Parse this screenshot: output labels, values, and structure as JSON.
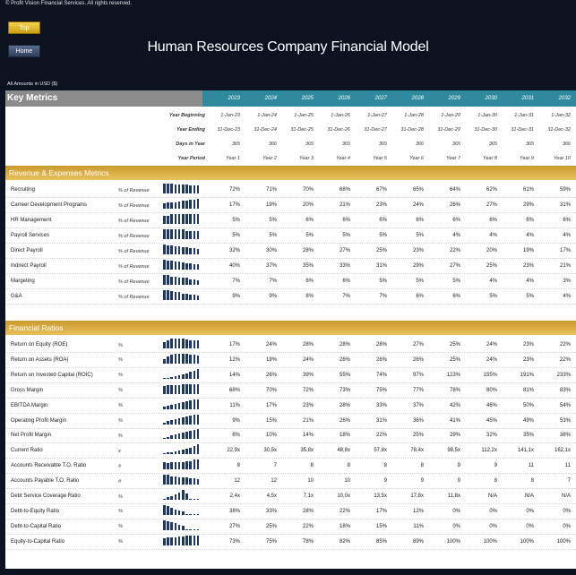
{
  "copyright": "© Profit Vision Financial Services. All rights reserved.",
  "nav": {
    "top_label": "Top",
    "home_label": "Home"
  },
  "title": "Human Resources Company Financial Model",
  "amounts_note": "All Amounts in  USD ($)",
  "key_metrics_label": "Key Metrics",
  "years": [
    "2023",
    "2024",
    "2025",
    "2026",
    "2027",
    "2028",
    "2029",
    "2030",
    "2031",
    "2032"
  ],
  "meta_rows": [
    {
      "label": "Year Beginning",
      "values": [
        "1-Jan-23",
        "1-Jan-24",
        "1-Jan-25",
        "1-Jan-26",
        "1-Jan-27",
        "1-Jan-28",
        "1-Jan-29",
        "1-Jan-30",
        "1-Jan-31",
        "1-Jan-32"
      ]
    },
    {
      "label": "Year Ending",
      "values": [
        "31-Dec-23",
        "31-Dec-24",
        "31-Dec-25",
        "31-Dec-26",
        "31-Dec-27",
        "31-Dec-28",
        "31-Dec-29",
        "31-Dec-30",
        "31-Dec-31",
        "31-Dec-32"
      ]
    },
    {
      "label": "Days in Year",
      "values": [
        "365",
        "366",
        "365",
        "365",
        "365",
        "366",
        "365",
        "365",
        "365",
        "366"
      ]
    },
    {
      "label": "Year Period",
      "values": [
        "Year 1",
        "Year 2",
        "Year 3",
        "Year 4",
        "Year 5",
        "Year 6",
        "Year 7",
        "Year 8",
        "Year 9",
        "Year 10"
      ]
    }
  ],
  "sections": [
    {
      "title": "Revenue & Expenses Metrics",
      "rows": [
        {
          "label": "Recruiting",
          "unit": "% of Revenue",
          "values": [
            "72%",
            "71%",
            "70%",
            "68%",
            "67%",
            "65%",
            "64%",
            "62%",
            "61%",
            "59%"
          ],
          "spark": [
            72,
            71,
            70,
            68,
            67,
            65,
            64,
            62,
            61,
            59
          ]
        },
        {
          "label": "Carreer Development Programs",
          "unit": "% of Revenue",
          "values": [
            "17%",
            "19%",
            "20%",
            "21%",
            "23%",
            "24%",
            "26%",
            "27%",
            "29%",
            "31%"
          ],
          "spark": [
            17,
            19,
            20,
            21,
            23,
            24,
            26,
            27,
            29,
            31
          ]
        },
        {
          "label": "HR Management",
          "unit": "% of Revenue",
          "values": [
            "5%",
            "5%",
            "6%",
            "6%",
            "6%",
            "6%",
            "6%",
            "6%",
            "6%",
            "6%"
          ],
          "spark": [
            5,
            5,
            6,
            6,
            6,
            6,
            6,
            6,
            6,
            6
          ]
        },
        {
          "label": "Payroll Services",
          "unit": "% of Revenue",
          "values": [
            "5%",
            "5%",
            "5%",
            "5%",
            "5%",
            "5%",
            "4%",
            "4%",
            "4%",
            "4%"
          ],
          "spark": [
            5,
            5,
            5,
            5,
            5,
            5,
            4,
            4,
            4,
            4
          ]
        },
        {
          "label": "Direct Payroll",
          "unit": "% of Revenue",
          "values": [
            "32%",
            "30%",
            "28%",
            "27%",
            "25%",
            "23%",
            "22%",
            "20%",
            "19%",
            "17%"
          ],
          "spark": [
            32,
            30,
            28,
            27,
            25,
            23,
            22,
            20,
            19,
            17
          ]
        },
        {
          "label": "Indirect Payroll",
          "unit": "% of Revenue",
          "values": [
            "40%",
            "37%",
            "35%",
            "33%",
            "31%",
            "29%",
            "27%",
            "25%",
            "23%",
            "21%"
          ],
          "spark": [
            40,
            37,
            35,
            33,
            31,
            29,
            27,
            25,
            23,
            21
          ]
        },
        {
          "label": "Margeting",
          "unit": "% of Revenue",
          "values": [
            "7%",
            "7%",
            "6%",
            "6%",
            "5%",
            "5%",
            "5%",
            "4%",
            "4%",
            "3%"
          ],
          "spark": [
            7,
            7,
            6,
            6,
            5,
            5,
            5,
            4,
            4,
            3
          ]
        },
        {
          "label": "G&A",
          "unit": "% of Revenue",
          "values": [
            "9%",
            "9%",
            "8%",
            "7%",
            "7%",
            "6%",
            "6%",
            "5%",
            "5%",
            "4%"
          ],
          "spark": [
            9,
            9,
            8,
            7,
            7,
            6,
            6,
            5,
            5,
            4
          ]
        }
      ]
    },
    {
      "title": "Financial Ratios",
      "rows": [
        {
          "label": "Return on Equity (ROE)",
          "unit": "%",
          "values": [
            "17%",
            "24%",
            "28%",
            "28%",
            "28%",
            "27%",
            "25%",
            "24%",
            "23%",
            "22%"
          ],
          "spark": [
            17,
            24,
            28,
            28,
            28,
            27,
            25,
            24,
            23,
            22
          ]
        },
        {
          "label": "Return on Assets (ROA)",
          "unit": "%",
          "values": [
            "12%",
            "19%",
            "24%",
            "26%",
            "26%",
            "26%",
            "25%",
            "24%",
            "23%",
            "22%"
          ],
          "spark": [
            12,
            19,
            24,
            26,
            26,
            26,
            25,
            24,
            23,
            22
          ]
        },
        {
          "label": "Return on Invested Capital (ROIC)",
          "unit": "%",
          "values": [
            "14%",
            "26%",
            "39%",
            "55%",
            "74%",
            "97%",
            "123%",
            "155%",
            "191%",
            "233%"
          ],
          "spark": [
            14,
            26,
            39,
            55,
            74,
            97,
            123,
            155,
            191,
            233
          ]
        },
        {
          "label": "Gross Margin",
          "unit": "%",
          "values": [
            "68%",
            "70%",
            "72%",
            "73%",
            "75%",
            "77%",
            "78%",
            "80%",
            "81%",
            "83%"
          ],
          "spark": [
            68,
            70,
            72,
            73,
            75,
            77,
            78,
            80,
            81,
            83
          ]
        },
        {
          "label": "EBITDA Margin",
          "unit": "%",
          "values": [
            "11%",
            "17%",
            "23%",
            "28%",
            "33%",
            "37%",
            "42%",
            "46%",
            "50%",
            "54%"
          ],
          "spark": [
            11,
            17,
            23,
            28,
            33,
            37,
            42,
            46,
            50,
            54
          ]
        },
        {
          "label": "Operating Profit Margin",
          "unit": "%",
          "values": [
            "9%",
            "15%",
            "21%",
            "26%",
            "31%",
            "36%",
            "41%",
            "45%",
            "49%",
            "53%"
          ],
          "spark": [
            9,
            15,
            21,
            26,
            31,
            36,
            41,
            45,
            49,
            53
          ]
        },
        {
          "label": "Net Profit Margin",
          "unit": "%",
          "values": [
            "6%",
            "10%",
            "14%",
            "18%",
            "22%",
            "25%",
            "29%",
            "32%",
            "35%",
            "38%"
          ],
          "spark": [
            6,
            10,
            14,
            18,
            22,
            25,
            29,
            32,
            35,
            38
          ]
        },
        {
          "label": "Current Ratio",
          "unit": "x",
          "values": [
            "22,9x",
            "30,5x",
            "35,8x",
            "48,8x",
            "57,8x",
            "78,4x",
            "98,5x",
            "112,2x",
            "141,1x",
            "162,1x"
          ],
          "spark": [
            22.9,
            30.5,
            35.8,
            48.8,
            57.8,
            78.4,
            98.5,
            112.2,
            141.1,
            162.1
          ]
        },
        {
          "label": "Accounts Receivable T.O. Ratio",
          "unit": "#",
          "values": [
            "8",
            "7",
            "8",
            "8",
            "8",
            "8",
            "9",
            "9",
            "11",
            "11"
          ],
          "spark": [
            8,
            7,
            8,
            8,
            8,
            8,
            9,
            9,
            11,
            11
          ]
        },
        {
          "label": "Accounts Payable T.O. Ratio",
          "unit": "#",
          "values": [
            "12",
            "12",
            "10",
            "10",
            "9",
            "9",
            "9",
            "8",
            "8",
            "7"
          ],
          "spark": [
            12,
            12,
            10,
            10,
            9,
            9,
            9,
            8,
            8,
            7
          ]
        },
        {
          "label": "Debt Service Coverage Ratio",
          "unit": "%",
          "values": [
            "2,4x",
            "4,5x",
            "7,1x",
            "10,0x",
            "13,5x",
            "17,8x",
            "11,8x",
            "N/A",
            "N/A",
            "N/A"
          ],
          "spark": [
            2.4,
            4.5,
            7.1,
            10.0,
            13.5,
            17.8,
            11.8,
            0,
            0,
            0
          ]
        },
        {
          "label": "Debt-to-Equity Ratio",
          "unit": "%",
          "values": [
            "38%",
            "33%",
            "28%",
            "22%",
            "17%",
            "12%",
            "0%",
            "0%",
            "0%",
            "0%"
          ],
          "spark": [
            38,
            33,
            28,
            22,
            17,
            12,
            0,
            0,
            0,
            0
          ]
        },
        {
          "label": "Debt-to-Capital Ratio",
          "unit": "%",
          "values": [
            "27%",
            "25%",
            "22%",
            "18%",
            "15%",
            "11%",
            "0%",
            "0%",
            "0%",
            "0%"
          ],
          "spark": [
            27,
            25,
            22,
            18,
            15,
            11,
            0,
            0,
            0,
            0
          ]
        },
        {
          "label": "Equity-to-Capital Ratio",
          "unit": "%",
          "values": [
            "73%",
            "75%",
            "78%",
            "82%",
            "85%",
            "89%",
            "100%",
            "100%",
            "100%",
            "100%"
          ],
          "spark": [
            73,
            75,
            78,
            82,
            85,
            89,
            100,
            100,
            100,
            100
          ]
        }
      ]
    }
  ]
}
